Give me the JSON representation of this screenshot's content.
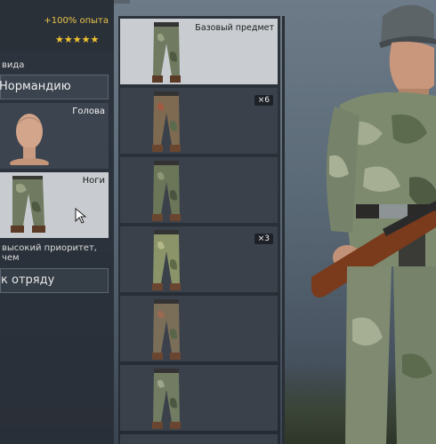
{
  "header": {
    "xp_bonus": "+100% опыта",
    "stars": "★★★★★"
  },
  "appearance": {
    "section_label": "вида",
    "map_select_value": "Нормандию",
    "slots": [
      {
        "label": "Голова"
      },
      {
        "label": "Ноги"
      }
    ],
    "note": "высокий приоритет, чем",
    "squad_button": "к отряду"
  },
  "items": [
    {
      "label": "Базовый предмет",
      "count": ""
    },
    {
      "label": "",
      "count": "×6"
    },
    {
      "label": "",
      "count": ""
    },
    {
      "label": "",
      "count": "×3"
    },
    {
      "label": "",
      "count": ""
    },
    {
      "label": "",
      "count": ""
    }
  ],
  "colors": {
    "accent_gold": "#e8c44a",
    "star": "#f2c531",
    "selected_card": "#c9cdd1"
  }
}
